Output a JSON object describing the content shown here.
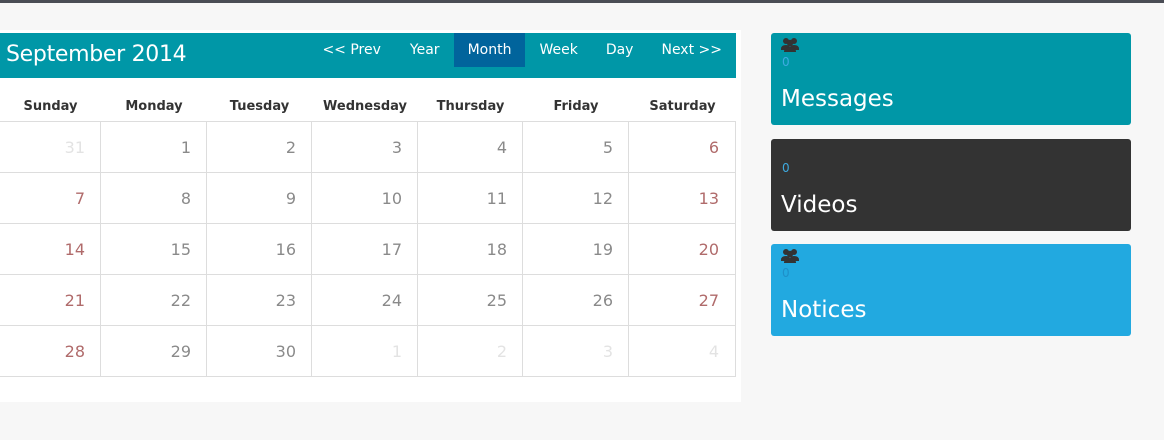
{
  "calendar": {
    "title": "September 2014",
    "nav": {
      "prev": "<< Prev",
      "year": "Year",
      "month": "Month",
      "week": "Week",
      "day": "Day",
      "next": "Next >>"
    },
    "days_of_week": [
      "Sunday",
      "Monday",
      "Tuesday",
      "Wednesday",
      "Thursday",
      "Friday",
      "Saturday"
    ],
    "weeks": [
      [
        "31",
        "1",
        "2",
        "3",
        "4",
        "5",
        "6"
      ],
      [
        "7",
        "8",
        "9",
        "10",
        "11",
        "12",
        "13"
      ],
      [
        "14",
        "15",
        "16",
        "17",
        "18",
        "19",
        "20"
      ],
      [
        "21",
        "22",
        "23",
        "24",
        "25",
        "26",
        "27"
      ],
      [
        "28",
        "29",
        "30",
        "1",
        "2",
        "3",
        "4"
      ]
    ]
  },
  "cards": {
    "messages": {
      "count": "0",
      "title": "Messages",
      "icon": "users-icon",
      "color": "#0097a7"
    },
    "videos": {
      "count": "0",
      "title": "Videos",
      "color": "#333333"
    },
    "notices": {
      "count": "0",
      "title": "Notices",
      "icon": "users-icon",
      "color": "#22a9e0"
    }
  },
  "colors": {
    "header": "#0097a7",
    "active_nav": "#01649c",
    "weekend_text": "#b06b6b"
  }
}
